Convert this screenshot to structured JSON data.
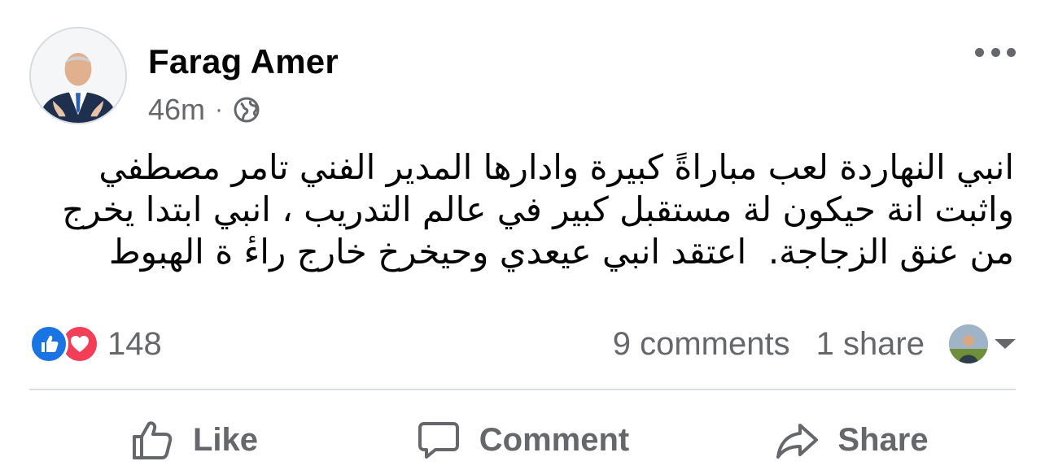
{
  "post": {
    "author": "Farag Amer",
    "time": "46m",
    "separator": "·",
    "audience_icon": "globe-icon",
    "text": "انبي النهاردة لعب مباراةً كبيرة وادارها المدير الفني تامر مصطفي واثبت انة حيكون لة مستقبل كبير في عالم التدريب ، انبي ابتدا يخرج من عنق الزجاجة.  اعتقد انبي عيعدي وحيخرخ خارج راءٔ ة الهبوط"
  },
  "reactions": {
    "icons": [
      "like-icon",
      "love-icon"
    ],
    "count": "148",
    "comments": "9 comments",
    "shares": "1 share"
  },
  "actions": {
    "like": "Like",
    "comment": "Comment",
    "share": "Share"
  },
  "colors": {
    "like_blue": "#1b74e4",
    "love_red": "#f33e58",
    "secondary_text": "#65676b"
  }
}
